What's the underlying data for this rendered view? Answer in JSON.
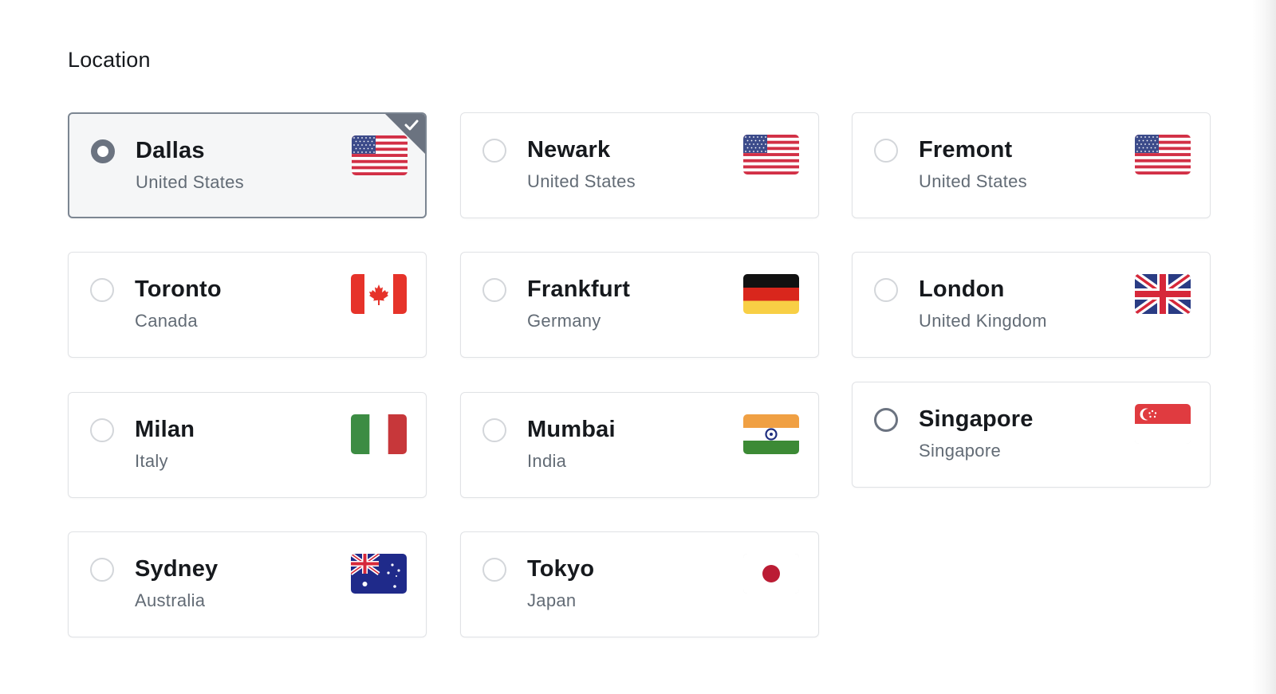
{
  "section": {
    "title": "Location"
  },
  "locations": [
    {
      "city": "Dallas",
      "country": "United States",
      "flag": "us-flag-icon",
      "selected": true
    },
    {
      "city": "Newark",
      "country": "United States",
      "flag": "us-flag-icon",
      "selected": false
    },
    {
      "city": "Fremont",
      "country": "United States",
      "flag": "us-flag-icon",
      "selected": false
    },
    {
      "city": "Toronto",
      "country": "Canada",
      "flag": "canada-flag-icon",
      "selected": false
    },
    {
      "city": "Frankfurt",
      "country": "Germany",
      "flag": "germany-flag-icon",
      "selected": false
    },
    {
      "city": "London",
      "country": "United Kingdom",
      "flag": "uk-flag-icon",
      "selected": false
    },
    {
      "city": "Milan",
      "country": "Italy",
      "flag": "italy-flag-icon",
      "selected": false
    },
    {
      "city": "Mumbai",
      "country": "India",
      "flag": "india-flag-icon",
      "selected": false
    },
    {
      "city": "Singapore",
      "country": "Singapore",
      "flag": "singapore-flag-icon",
      "selected": false,
      "focused": true
    },
    {
      "city": "Sydney",
      "country": "Australia",
      "flag": "australia-flag-icon",
      "selected": false
    },
    {
      "city": "Tokyo",
      "country": "Japan",
      "flag": "japan-flag-icon",
      "selected": false
    }
  ],
  "colors": {
    "selected_accent": "#6b7380",
    "card_border": "#e0e2e5",
    "selected_background": "#f5f6f7",
    "secondary_text": "#626b75"
  }
}
